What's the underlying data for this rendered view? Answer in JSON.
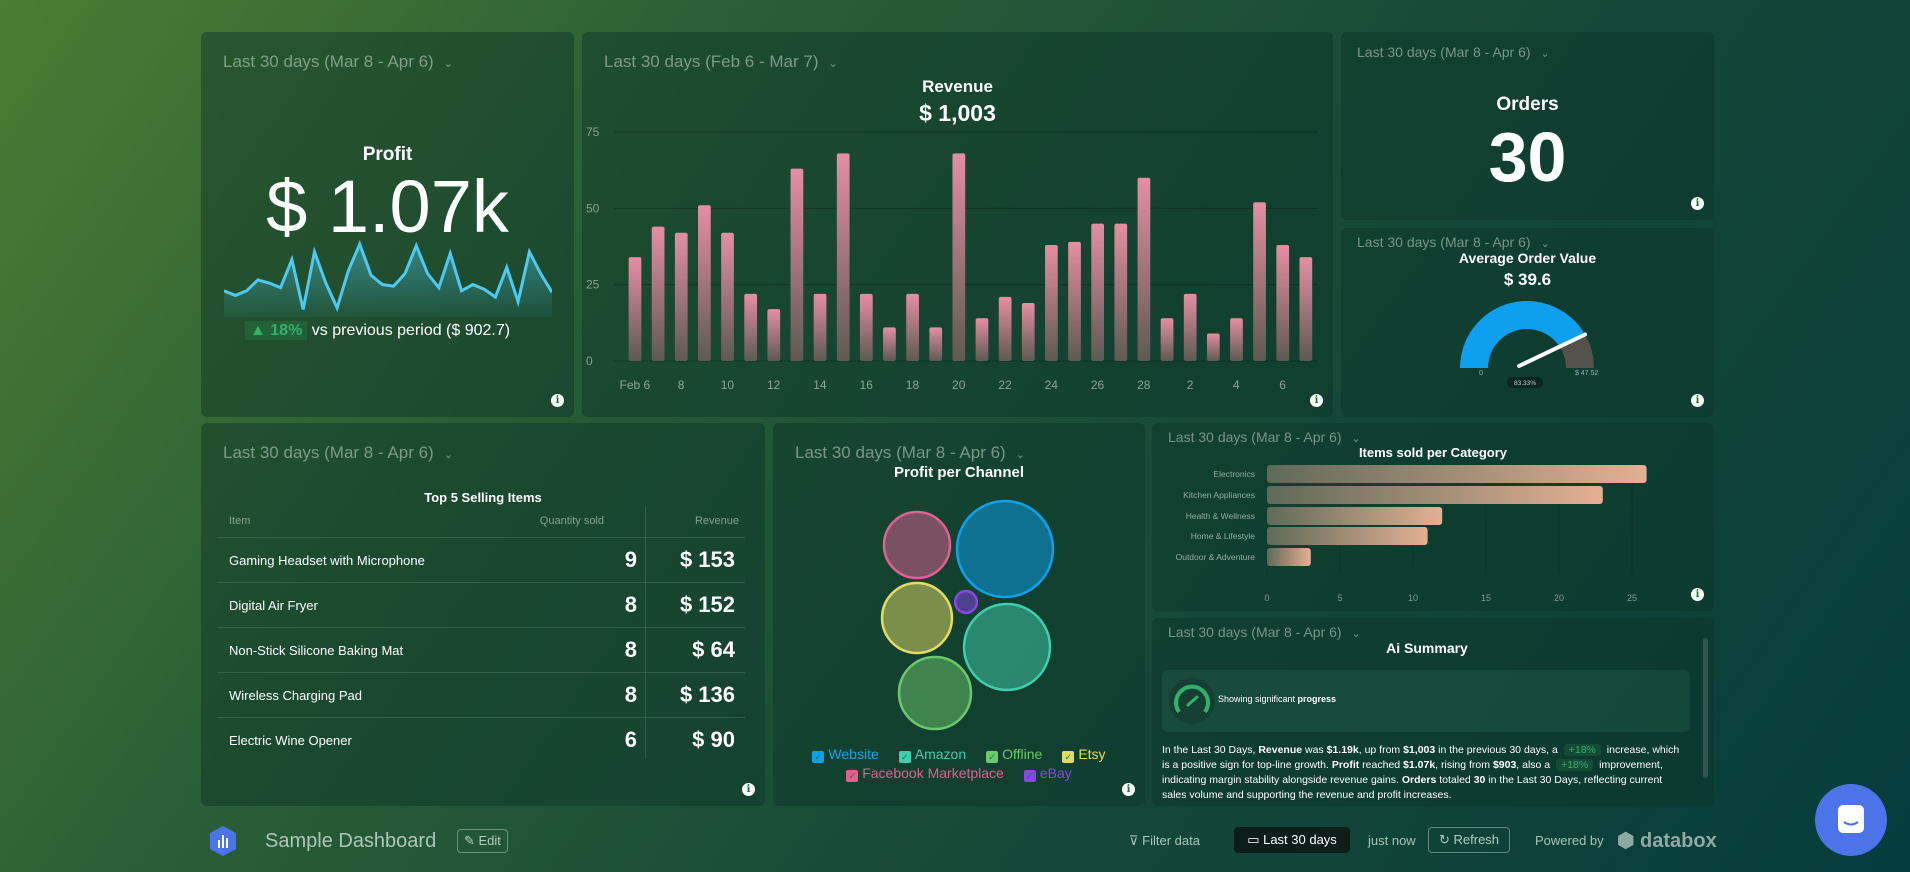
{
  "colors": {
    "accent_pink": "#e58ea4",
    "sparkline": "#4fc9ef",
    "gauge_fill": "#0ea0ee",
    "gauge_rest": "#54504c",
    "positive": "#2fb36a",
    "bar_category": "#e4b094"
  },
  "profit": {
    "date_label": "Last 30 days (Mar 8 - Apr 6)",
    "title": "Profit",
    "value": "$ 1.07k",
    "delta": "▲ 18%",
    "comparison": "vs previous period ($ 902.7)",
    "sparkline": [
      13,
      10,
      13,
      20,
      18,
      15,
      33,
      1,
      38,
      18,
      2,
      26,
      43,
      23,
      17,
      16,
      24,
      42,
      24,
      15,
      37,
      13,
      17,
      14,
      9,
      28,
      6,
      38,
      24,
      12
    ]
  },
  "revenue": {
    "date_label": "Last 30 days (Feb 6 - Mar 7)",
    "title": "Revenue",
    "value": "$ 1,003"
  },
  "orders": {
    "date_label": "Last 30 days (Mar 8 - Apr 6)",
    "title": "Orders",
    "value": "30"
  },
  "aov": {
    "date_label": "Last 30 days (Mar 8 - Apr 6)",
    "title": "Average Order Value",
    "value": "$ 39.6",
    "gauge_min": "0",
    "gauge_max": "$ 47.52",
    "gauge_percent": "83.33%",
    "gauge_fraction": 0.8333
  },
  "top_items": {
    "date_label": "Last 30 days (Mar 8 - Apr 6)",
    "title": "Top 5 Selling Items",
    "headers": [
      "Item",
      "Quantity sold",
      "Revenue"
    ],
    "rows": [
      {
        "item": "Gaming Headset with Microphone",
        "qty": "9",
        "rev": "$ 153"
      },
      {
        "item": "Digital Air Fryer",
        "qty": "8",
        "rev": "$ 152"
      },
      {
        "item": "Non-Stick Silicone Baking Mat",
        "qty": "8",
        "rev": "$ 64"
      },
      {
        "item": "Wireless Charging Pad",
        "qty": "8",
        "rev": "$ 136"
      },
      {
        "item": "Electric Wine Opener",
        "qty": "6",
        "rev": "$ 90"
      }
    ]
  },
  "channel": {
    "date_label": "Last 30 days (Mar 8 - Apr 6)",
    "title": "Profit per Channel",
    "legend": [
      {
        "name": "Website",
        "color": "#0aa2f0"
      },
      {
        "name": "Amazon",
        "color": "#3fcfae"
      },
      {
        "name": "Offline",
        "color": "#6cc86a"
      },
      {
        "name": "Etsy",
        "color": "#e3dc64"
      },
      {
        "name": "Facebook Marketplace",
        "color": "#e0608f"
      },
      {
        "name": "eBay",
        "color": "#8a44e8"
      }
    ]
  },
  "category": {
    "date_label": "Last 30 days (Mar 8 - Apr 6)"
  },
  "ai": {
    "date_label": "Last 30 days (Mar 8 - Apr 6)",
    "title": "Ai Summary",
    "status_prefix": "Showing significant ",
    "status_bold": "progress",
    "p": [
      "In the Last 30 Days, ",
      "Revenue",
      " was ",
      "$1.19k",
      ", up from ",
      "$1,003",
      " in the previous 30 days, a ",
      "+18%",
      " increase, which is a positive sign for top-line growth. ",
      "Profit",
      " reached ",
      "$1.07k",
      ", rising from ",
      "$903",
      ", also a ",
      "+18%",
      " improvement, indicating margin stability alongside revenue gains. ",
      "Orders",
      " totaled ",
      "30",
      " in the Last 30 Days, reflecting current sales volume and supporting the revenue and profit increases."
    ]
  },
  "footer": {
    "dashboard_name": "Sample Dashboard",
    "edit": "Edit",
    "filter": "Filter data",
    "date_button": "Last 30 days",
    "updated": "just now",
    "refresh": "Refresh",
    "powered": "Powered by",
    "brand": "databox"
  },
  "chart_data": [
    {
      "type": "bar",
      "title": "Revenue",
      "categories": [
        "Feb 6",
        "Feb 7",
        "Feb 8",
        "Feb 9",
        "Feb 10",
        "Feb 11",
        "Feb 12",
        "Feb 13",
        "Feb 14",
        "Feb 15",
        "Feb 16",
        "Feb 17",
        "Feb 18",
        "Feb 19",
        "Feb 20",
        "Feb 21",
        "Feb 22",
        "Feb 23",
        "Feb 24",
        "Feb 25",
        "Feb 26",
        "Feb 27",
        "Feb 28",
        "Mar 1",
        "Mar 2",
        "Mar 3",
        "Mar 4",
        "Mar 5",
        "Mar 6",
        "Mar 7"
      ],
      "x_tick_labels": [
        "Feb 6",
        "8",
        "10",
        "12",
        "14",
        "16",
        "18",
        "20",
        "22",
        "24",
        "26",
        "28",
        "2",
        "4",
        "6"
      ],
      "values": [
        34,
        44,
        42,
        51,
        42,
        22,
        17,
        63,
        22,
        68,
        22,
        11,
        22,
        11,
        68,
        14,
        21,
        19,
        38,
        39,
        45,
        45,
        60,
        14,
        22,
        9,
        14,
        52,
        38,
        34
      ],
      "ylim": [
        0,
        75
      ],
      "y_ticks": [
        "0",
        "25",
        "50",
        "75"
      ],
      "grid": true
    },
    {
      "type": "bar",
      "orientation": "horizontal",
      "title": "Items sold per Category",
      "categories": [
        "Electronics",
        "Kitchen Appliances",
        "Health & Wellness",
        "Home & Lifestyle",
        "Outdoor & Adventure"
      ],
      "values": [
        26,
        23,
        12,
        11,
        3
      ],
      "xlim": [
        0,
        30
      ],
      "x_ticks": [
        "0",
        "5",
        "10",
        "15",
        "20",
        "25"
      ]
    },
    {
      "type": "bubble",
      "title": "Profit per Channel",
      "categories": [
        "Website",
        "Amazon",
        "Offline",
        "Etsy",
        "Facebook Marketplace",
        "eBay"
      ],
      "values": [
        313,
        251,
        176,
        166,
        148,
        16
      ]
    }
  ]
}
